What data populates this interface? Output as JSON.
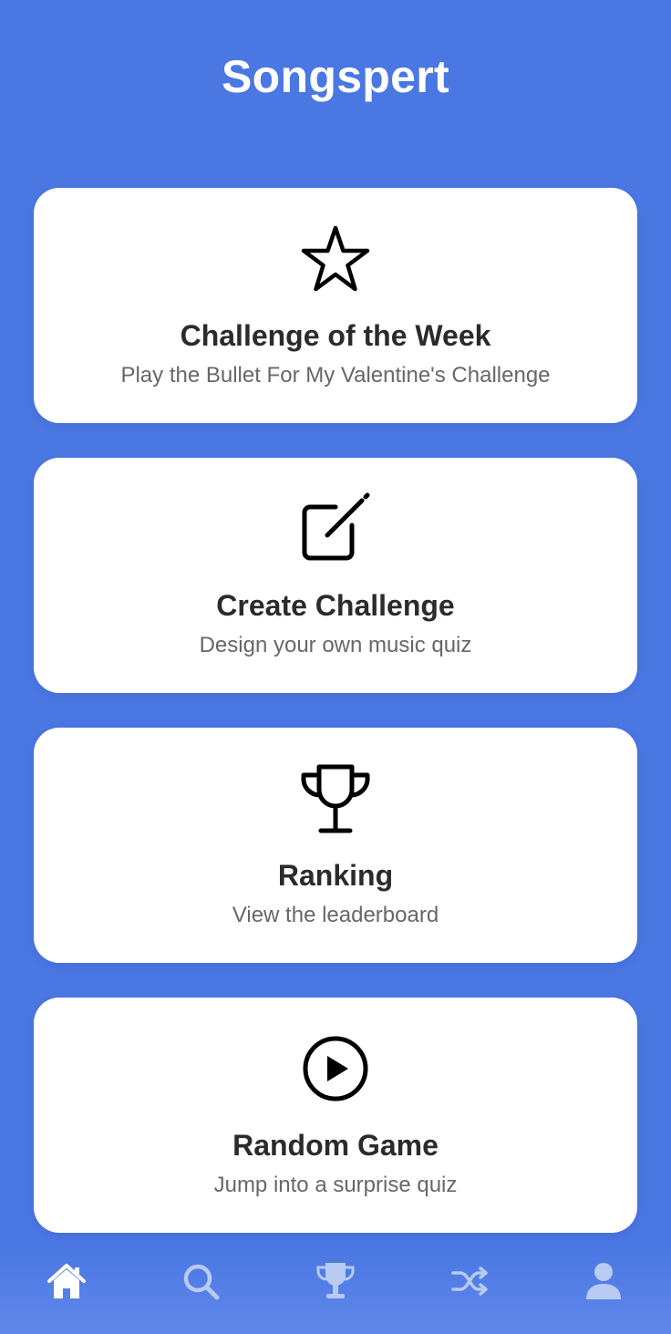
{
  "app": {
    "title": "Songspert"
  },
  "cards": [
    {
      "icon": "star-icon",
      "title": "Challenge of the Week",
      "subtitle": "Play the Bullet For My Valentine's Challenge"
    },
    {
      "icon": "edit-icon",
      "title": "Create Challenge",
      "subtitle": "Design your own music quiz"
    },
    {
      "icon": "trophy-icon",
      "title": "Ranking",
      "subtitle": "View the leaderboard"
    },
    {
      "icon": "play-circle-icon",
      "title": "Random Game",
      "subtitle": "Jump into a surprise quiz"
    }
  ],
  "tabbar": {
    "items": [
      {
        "icon": "home-icon",
        "active": true
      },
      {
        "icon": "search-icon",
        "active": false
      },
      {
        "icon": "trophy-icon",
        "active": false
      },
      {
        "icon": "shuffle-icon",
        "active": false
      },
      {
        "icon": "profile-icon",
        "active": false
      }
    ]
  },
  "colors": {
    "background": "#4b77e3",
    "card": "#ffffff",
    "title_text": "#2b2b2b",
    "subtitle_text": "#676767",
    "tab_active": "#ffffff",
    "tab_inactive": "#b9cbf5"
  }
}
